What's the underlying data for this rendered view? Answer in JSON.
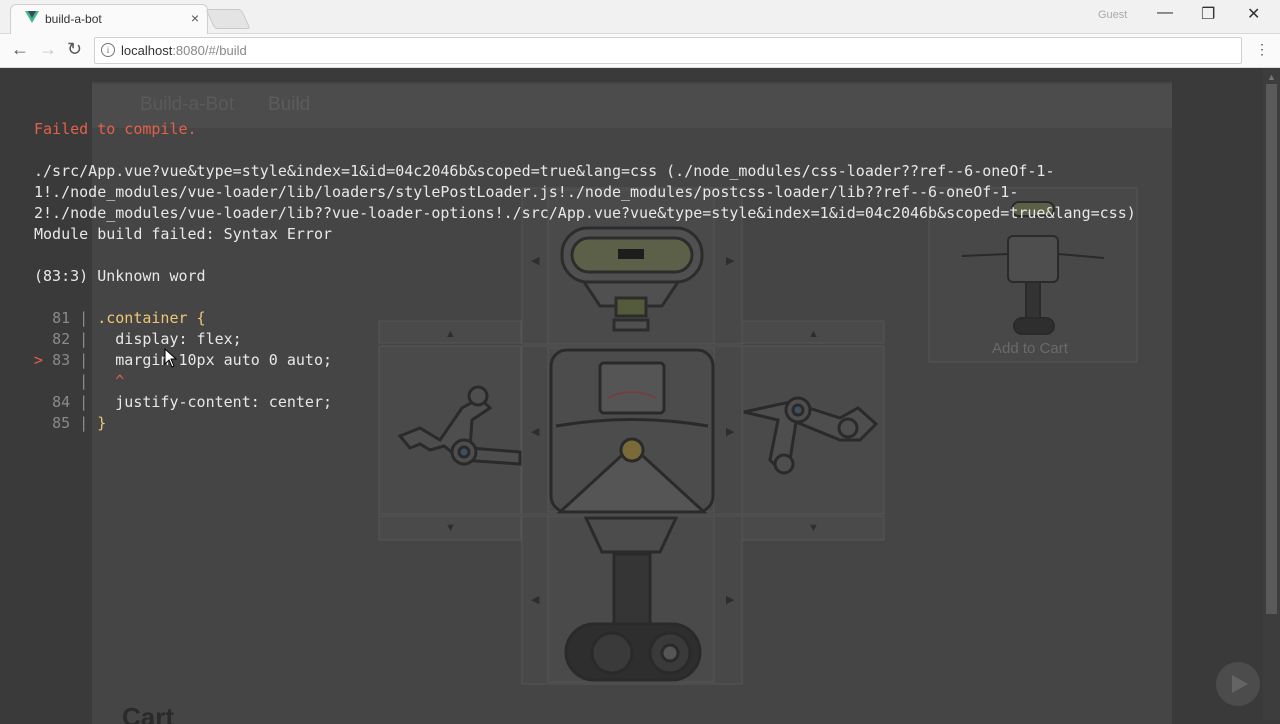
{
  "browser": {
    "tab_title": "build-a-bot",
    "tab_close": "×",
    "profile": "Guest",
    "controls": {
      "minimize": "—",
      "maximize": "❐",
      "close": "✕"
    },
    "nav": {
      "back": "←",
      "forward": "→",
      "reload": "↻"
    },
    "url_host": "localhost",
    "url_rest": ":8080/#/build",
    "info_icon": "i",
    "menu": "⋮"
  },
  "app": {
    "logo_text": "Build-a-Bot",
    "nav_build": "Build",
    "add_to_cart": "Add to Cart",
    "cart_heading": "Cart"
  },
  "error": {
    "title": "Failed to compile.",
    "path_line1": "./src/App.vue?vue&type=style&index=1&id=04c2046b&scoped=true&lang=css (./node_modules/css-loader??ref--6-oneOf-1-",
    "path_line2": "1!./node_modules/vue-loader/lib/loaders/stylePostLoader.js!./node_modules/postcss-loader/lib??ref--6-oneOf-1-",
    "path_line3": "2!./node_modules/vue-loader/lib??vue-loader-options!./src/App.vue?vue&type=style&index=1&id=04c2046b&scoped=true&lang=css)",
    "summary": "Module build failed: Syntax Error",
    "location": "(83:3) Unknown word",
    "code": [
      {
        "marker": "  ",
        "num": "81",
        "text": ".container {",
        "selector": true
      },
      {
        "marker": "  ",
        "num": "82",
        "text": "  display: flex;",
        "selector": false
      },
      {
        "marker": "> ",
        "num": "83",
        "text": "  margin 10px auto 0 auto;",
        "selector": false
      },
      {
        "marker": "  ",
        "num": "  ",
        "text": "  ^",
        "caret": true
      },
      {
        "marker": "  ",
        "num": "84",
        "text": "  justify-content: center;",
        "selector": false
      },
      {
        "marker": "  ",
        "num": "85",
        "text": "}",
        "selector": true
      }
    ]
  },
  "colors": {
    "error_red": "#e36049",
    "selector_yellow": "#f0c674",
    "vue_green": "#41b883"
  }
}
